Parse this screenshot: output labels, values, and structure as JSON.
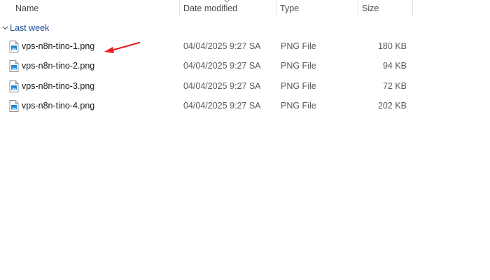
{
  "columns": {
    "name": "Name",
    "date": "Date modified",
    "type": "Type",
    "size": "Size"
  },
  "group": {
    "label": "Last week",
    "expanded": true
  },
  "files": [
    {
      "name": "vps-n8n-tino-1.png",
      "date": "04/04/2025 9:27 SA",
      "type": "PNG File",
      "size": "180 KB"
    },
    {
      "name": "vps-n8n-tino-2.png",
      "date": "04/04/2025 9:27 SA",
      "type": "PNG File",
      "size": "94 KB"
    },
    {
      "name": "vps-n8n-tino-3.png",
      "date": "04/04/2025 9:27 SA",
      "type": "PNG File",
      "size": "72 KB"
    },
    {
      "name": "vps-n8n-tino-4.png",
      "date": "04/04/2025 9:27 SA",
      "type": "PNG File",
      "size": "202 KB"
    }
  ],
  "icons": {
    "file": "png-file-icon",
    "group_toggle": "chevron-down-icon",
    "sort": "sort-indicator-icon",
    "annotation": "red-arrow-annotation"
  },
  "colors": {
    "group_label": "#1c4f93",
    "annotation": "#e81c1c",
    "file_icon_accent": "#1e88d6"
  }
}
